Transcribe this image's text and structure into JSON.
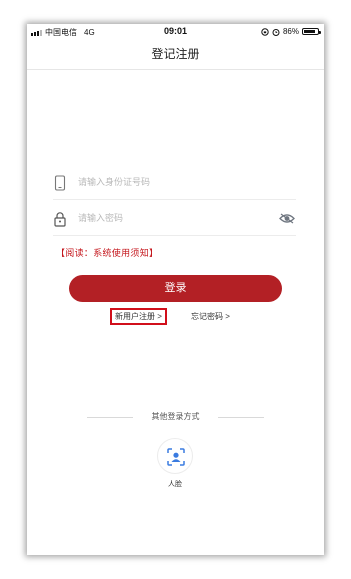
{
  "status_bar": {
    "carrier": "中国电信",
    "network": "4G",
    "time": "09:01",
    "battery_text": "86%",
    "battery_level": 0.86
  },
  "nav": {
    "title": "登记注册"
  },
  "form": {
    "id_placeholder": "请输入身份证号码",
    "password_placeholder": "请输入密码"
  },
  "notice": "【阅读：系统使用须知】",
  "login_button": "登录",
  "links": {
    "register": "新用户注册 >",
    "forgot": "忘记密码 >"
  },
  "other_login": {
    "title": "其他登录方式",
    "face_label": "人脸"
  },
  "colors": {
    "brand_red": "#b32025",
    "notice_red": "#c4161c",
    "face_icon_blue": "#3a7be0"
  },
  "icons": {
    "phone": "phone-icon",
    "lock": "lock-icon",
    "eye": "eye-icon",
    "face": "face-scan-icon"
  }
}
